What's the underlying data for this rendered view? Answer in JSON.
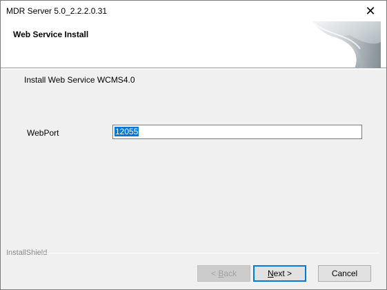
{
  "window": {
    "title": "MDR Server 5.0_2.2.2.0.31",
    "close_glyph": "✕"
  },
  "banner": {
    "title": "Web Service Install"
  },
  "content": {
    "description": "Install Web Service WCMS4.0",
    "port_label": "WebPort",
    "port_value": "12055"
  },
  "footer": {
    "brand": "InstallShield",
    "back_prefix": "< ",
    "back_mnemonic": "B",
    "back_rest": "ack",
    "next_mnemonic": "N",
    "next_rest": "ext >",
    "cancel_label": "Cancel"
  },
  "colors": {
    "selection": "#0078d7",
    "dialog_bg": "#f0f0f0"
  }
}
